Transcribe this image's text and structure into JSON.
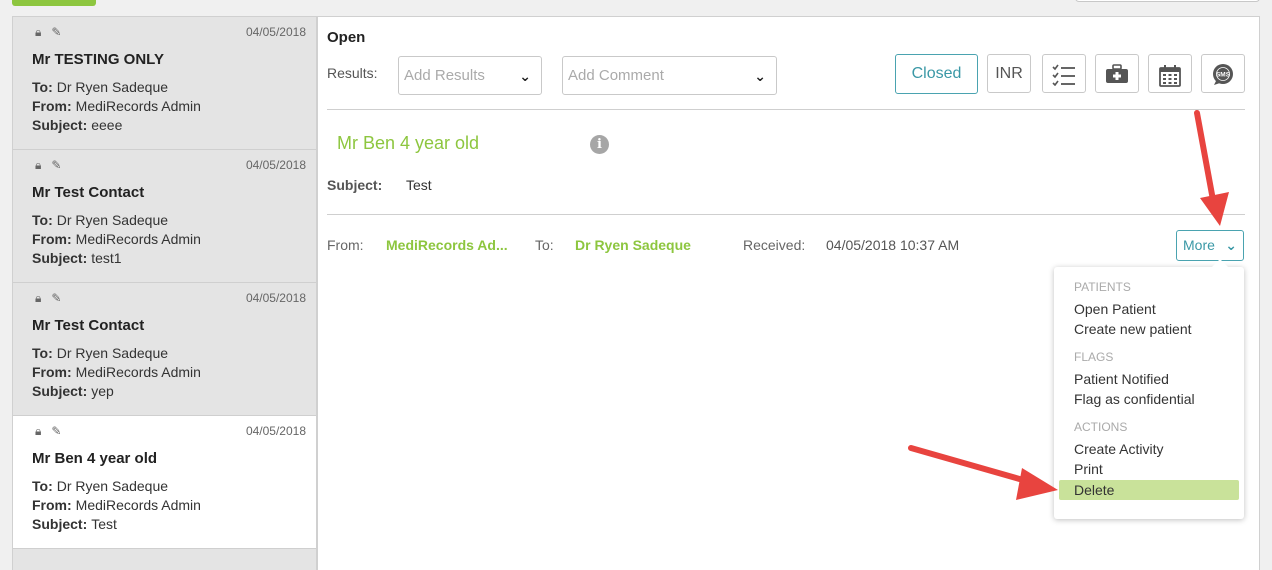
{
  "messages": [
    {
      "date": "04/05/2018",
      "name": "Mr TESTING ONLY",
      "to_label": "To:",
      "to": "Dr Ryen Sadeque",
      "from_label": "From:",
      "from": "MediRecords Admin",
      "subject_label": "Subject:",
      "subject": "eeee"
    },
    {
      "date": "04/05/2018",
      "name": "Mr Test Contact",
      "to_label": "To:",
      "to": "Dr Ryen Sadeque",
      "from_label": "From:",
      "from": "MediRecords Admin",
      "subject_label": "Subject:",
      "subject": "test1"
    },
    {
      "date": "04/05/2018",
      "name": "Mr Test Contact",
      "to_label": "To:",
      "to": "Dr Ryen Sadeque",
      "from_label": "From:",
      "from": "MediRecords Admin",
      "subject_label": "Subject:",
      "subject": "yep"
    },
    {
      "date": "04/05/2018",
      "name": "Mr Ben 4 year old",
      "to_label": "To:",
      "to": "Dr Ryen Sadeque",
      "from_label": "From:",
      "from": "MediRecords Admin",
      "subject_label": "Subject:",
      "subject": "Test"
    }
  ],
  "detail": {
    "status": "Open",
    "results_label": "Results:",
    "results_placeholder": "Add Results",
    "comment_placeholder": "Add Comment",
    "closed_label": "Closed",
    "inr_label": "INR",
    "patient_name": "Mr Ben 4 year old",
    "info_icon": "i",
    "subject_label": "Subject:",
    "subject": "Test",
    "from_label": "From:",
    "from": "MediRecords Ad...",
    "to_label": "To:",
    "to": "Dr Ryen Sadeque",
    "received_label": "Received:",
    "received": "04/05/2018 10:37 AM",
    "more_label": "More"
  },
  "menu": {
    "patients_header": "PATIENTS",
    "open_patient": "Open Patient",
    "create_patient": "Create new patient",
    "flags_header": "FLAGS",
    "patient_notified": "Patient Notified",
    "flag_confidential": "Flag as confidential",
    "actions_header": "ACTIONS",
    "create_activity": "Create Activity",
    "print": "Print",
    "delete": "Delete"
  },
  "colors": {
    "accent_green": "#8dc63f",
    "accent_teal": "#3a98a6",
    "highlight": "#c9e29a",
    "annotation_red": "#e8443f"
  },
  "icons": [
    "lock-icon",
    "note-icon",
    "checklist-icon",
    "medical-kit-icon",
    "calendar-icon",
    "sms-icon",
    "info-icon",
    "chevron-down-icon"
  ]
}
